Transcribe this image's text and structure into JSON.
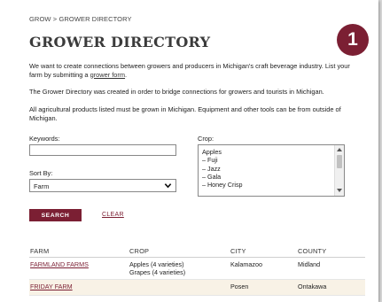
{
  "breadcrumb": {
    "home": "GROW",
    "separator": ">",
    "current": "GROWER DIRECTORY"
  },
  "title": "GROWER DIRECTORY",
  "step_badge": "1",
  "intro": {
    "p1_text": "We want to create connections between growers and producers in Michigan's craft beverage industry. List your farm by submitting a ",
    "p1_link": "grower form",
    "p1_end": ".",
    "p2": "The Grower Directory was created in order to bridge connections for growers and  tourists in Michigan.",
    "p3": "All agricultural products listed must be grown in Michigan. Equipment and other tools can be from outside of Michigan."
  },
  "filters": {
    "keywords_label": "Keywords:",
    "keywords_value": "",
    "crop_label": "Crop:",
    "crop_options": [
      "Apples",
      "– Fuji",
      "– Jazz",
      "– Gala",
      "– Honey Crisp"
    ],
    "sort_label": "Sort By:",
    "sort_value": "Farm",
    "search_label": "SEARCH",
    "clear_label": "CLEAR"
  },
  "results": {
    "headers": [
      "FARM",
      "CROP",
      "CITY",
      "COUNTY"
    ],
    "rows": [
      {
        "farm": "FARMLAND FARMS",
        "crop_line1": "Apples (4 varieties)",
        "crop_line2": "Grapes (4 varieties)",
        "city": "Kalamazoo",
        "county": "Midland"
      },
      {
        "farm": "FRIDAY FARM",
        "crop_line1": "",
        "crop_line2": "",
        "city": "Posen",
        "county": "Ontakawa"
      }
    ]
  },
  "colors": {
    "accent": "#7b1f33",
    "alt_row": "#f8f2e6"
  }
}
